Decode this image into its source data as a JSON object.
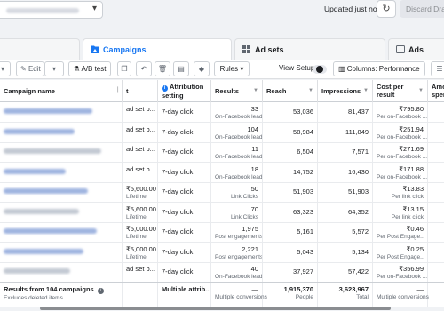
{
  "topbar": {
    "updated_text": "Updated just now",
    "discard_label": "Discard Drafts"
  },
  "tabs": [
    {
      "label": ""
    },
    {
      "label": "Campaigns"
    },
    {
      "label": "Ad sets"
    },
    {
      "label": "Ads"
    }
  ],
  "toolbar": {
    "edit_label": "Edit",
    "ab_test_label": "A/B test",
    "rules_label": "Rules",
    "view_setup_label": "View Setup",
    "columns_label": "Columns: Performance"
  },
  "columns": {
    "name": "Campaign name",
    "bid": "t",
    "attribution": "Attribution setting",
    "results": "Results",
    "reach": "Reach",
    "impressions": "Impressions",
    "cost": "Cost per result",
    "amount": "Amo spen"
  },
  "rows": [
    {
      "bid": "ad set b...",
      "bid_sub": "",
      "attribution": "7-day click",
      "results": "33",
      "results_sub": "On-Facebook leads",
      "reach": "53,036",
      "impressions": "81,437",
      "cost": "₹795.80",
      "cost_sub": "Per on-Facebook ..."
    },
    {
      "bid": "ad set b...",
      "bid_sub": "",
      "attribution": "7-day click",
      "results": "104",
      "results_sub": "On-Facebook leads",
      "reach": "58,984",
      "impressions": "111,849",
      "cost": "₹251.94",
      "cost_sub": "Per on-Facebook ..."
    },
    {
      "bid": "ad set b...",
      "bid_sub": "",
      "attribution": "7-day click",
      "results": "11",
      "results_sub": "On-Facebook leads",
      "reach": "6,504",
      "impressions": "7,571",
      "cost": "₹271.69",
      "cost_sub": "Per on-Facebook ..."
    },
    {
      "bid": "ad set b...",
      "bid_sub": "",
      "attribution": "7-day click",
      "results": "18",
      "results_sub": "On-Facebook leads",
      "reach": "14,752",
      "impressions": "16,430",
      "cost": "₹171.88",
      "cost_sub": "Per on-Facebook ..."
    },
    {
      "bid": "₹5,600.00",
      "bid_sub": "Lifetime",
      "attribution": "7-day click",
      "results": "50",
      "results_sub": "Link Clicks",
      "reach": "51,903",
      "impressions": "51,903",
      "cost": "₹13.83",
      "cost_sub": "Per link click"
    },
    {
      "bid": "₹5,600.00",
      "bid_sub": "Lifetime",
      "attribution": "7-day click",
      "results": "70",
      "results_sub": "Link Clicks",
      "reach": "63,323",
      "impressions": "64,352",
      "cost": "₹13.15",
      "cost_sub": "Per link click"
    },
    {
      "bid": "₹5,000.00",
      "bid_sub": "Lifetime",
      "attribution": "7-day click",
      "results": "1,975",
      "results_sub": "Post engagements",
      "reach": "5,161",
      "impressions": "5,572",
      "cost": "₹0.46",
      "cost_sub": "Per Post Engage..."
    },
    {
      "bid": "₹5,000.00",
      "bid_sub": "Lifetime",
      "attribution": "7-day click",
      "results": "2,221",
      "results_sub": "Post engagements",
      "reach": "5,043",
      "impressions": "5,134",
      "cost": "₹0.25",
      "cost_sub": "Per Post Engage..."
    },
    {
      "bid": "ad set b...",
      "bid_sub": "",
      "attribution": "7-day click",
      "results": "40",
      "results_sub": "On-Facebook leads",
      "reach": "37,927",
      "impressions": "57,422",
      "cost": "₹356.99",
      "cost_sub": "Per on-Facebook ..."
    }
  ],
  "footer": {
    "summary": "Results from 104 campaigns",
    "summary_sub": "Excludes deleted items",
    "attribution": "Multiple attrib...",
    "results": "—",
    "results_sub": "Multiple conversions",
    "reach": "1,915,370",
    "reach_sub": "People",
    "impressions": "3,623,967",
    "impressions_sub": "Total",
    "cost": "—",
    "cost_sub": "Multiple conversions"
  },
  "colors": {
    "accent": "#1877f2",
    "blurred_name": "#9fb4e0"
  }
}
